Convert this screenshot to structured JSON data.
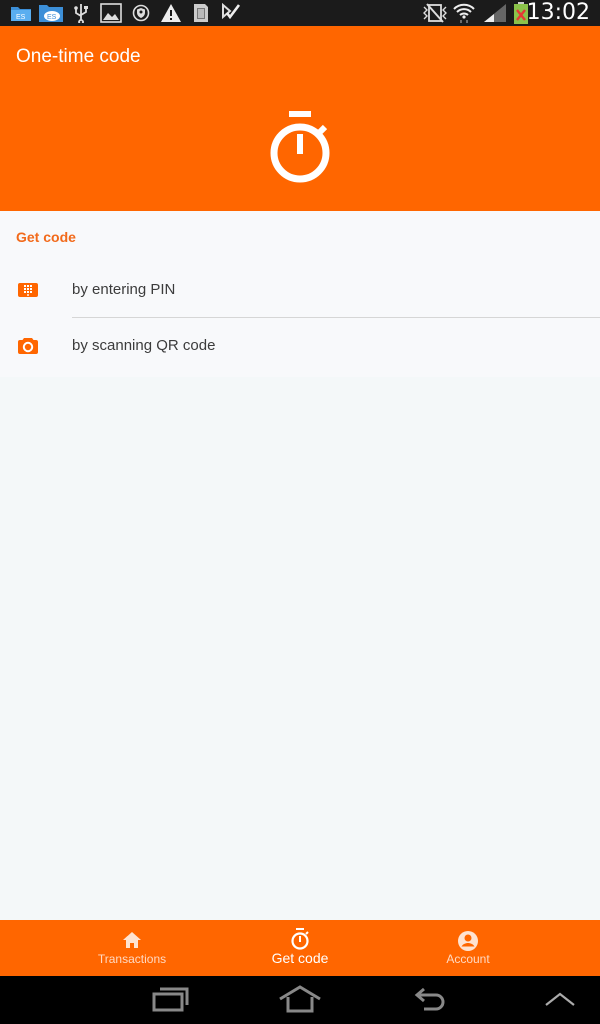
{
  "status_bar": {
    "time": "13:02",
    "left_icons": [
      "es-file-explorer-icon",
      "es-cloud-icon",
      "usb-icon",
      "image-icon",
      "vpn-shield-icon",
      "warning-icon",
      "sd-card-icon",
      "task-check-icon"
    ],
    "right_icons": [
      "mute-vibrate-icon",
      "wifi-icon",
      "signal-icon",
      "battery-charging-icon"
    ]
  },
  "app_bar": {
    "title": "One-time code",
    "hero_icon": "stopwatch-icon"
  },
  "section": {
    "header": "Get code",
    "items": [
      {
        "label": "by entering PIN",
        "icon": "dialpad-icon"
      },
      {
        "label": "by scanning QR code",
        "icon": "camera-icon"
      }
    ]
  },
  "bottom_nav": {
    "items": [
      {
        "label": "Transactions",
        "icon": "home-icon",
        "active": false
      },
      {
        "label": "Get code",
        "icon": "stopwatch-icon",
        "active": true
      },
      {
        "label": "Account",
        "icon": "account-circle-icon",
        "active": false
      }
    ]
  },
  "system_nav": {
    "buttons": [
      "recent-apps",
      "home",
      "back",
      "expand"
    ]
  },
  "colors": {
    "accent": "#ff6600",
    "section_header": "#f26a1b",
    "background": "#f4f8f9"
  }
}
